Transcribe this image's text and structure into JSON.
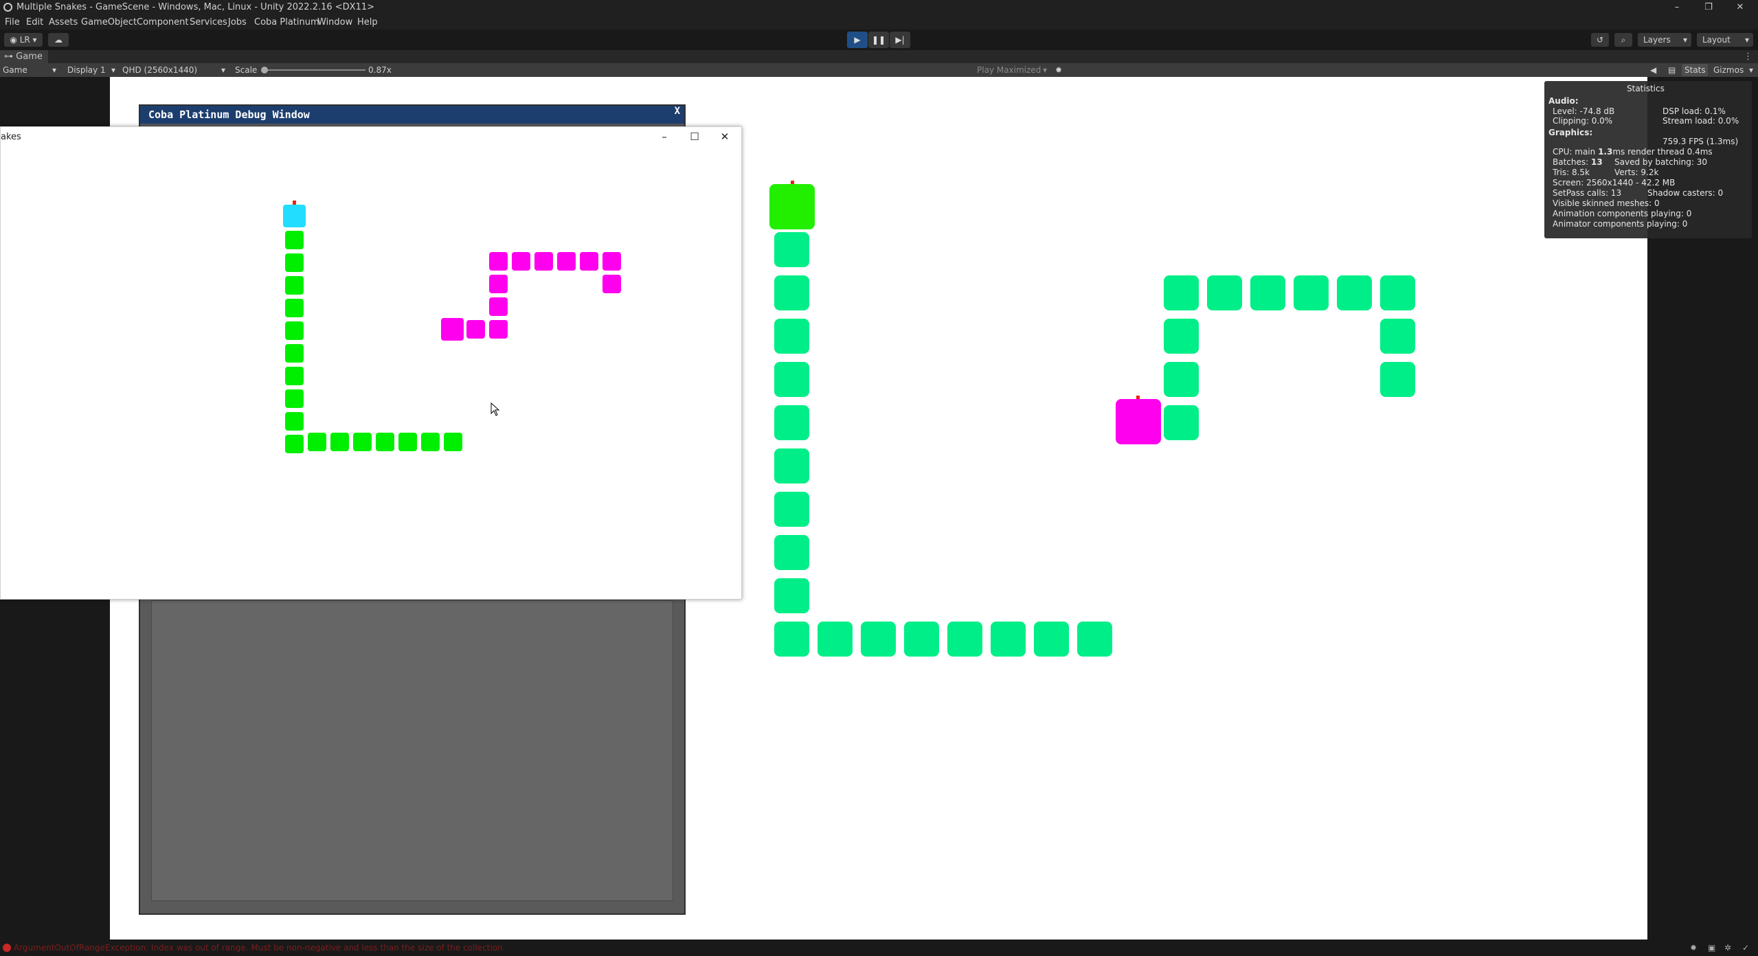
{
  "window": {
    "title": "Multiple Snakes - GameScene - Windows, Mac, Linux - Unity 2022.2.16 <DX11>",
    "controls": [
      "–",
      "❐",
      "✕"
    ]
  },
  "menubar": [
    "File",
    "Edit",
    "Assets",
    "GameObject",
    "Component",
    "Services",
    "Jobs",
    "Coba Platinum",
    "Window",
    "Help"
  ],
  "toolbar": {
    "account": "LR",
    "layers": "Layers",
    "layout": "Layout"
  },
  "game_tab": {
    "label": "Game"
  },
  "game_toolbar": {
    "view": "Game",
    "display": "Display 1",
    "resolution": "QHD (2560x1440)",
    "scale_label": "Scale",
    "scale_value": "0.87x",
    "play_mode": "Play Maximized",
    "stats": "Stats",
    "gizmos": "Gizmos"
  },
  "debug_window": {
    "title": "Coba Platinum Debug Window",
    "close": "X"
  },
  "floating_window": {
    "title": "akes",
    "controls": [
      "–",
      "☐",
      "✕"
    ]
  },
  "statistics": {
    "title": "Statistics",
    "audio_label": "Audio:",
    "level": "Level: -74.8 dB",
    "dsp_load": "DSP load: 0.1%",
    "clipping": "Clipping: 0.0%",
    "stream_load": "Stream load: 0.0%",
    "graphics_label": "Graphics:",
    "fps": "759.3 FPS (1.3ms)",
    "cpu_prefix": "CPU: main ",
    "cpu_main": "1.3",
    "cpu_suffix": "ms  render thread 0.4ms",
    "batches_prefix": "Batches: ",
    "batches": "13",
    "saved_by_batching": "Saved by batching: 30",
    "tris": "Tris: 8.5k",
    "verts": "Verts: 9.2k",
    "screen": "Screen: 2560x1440 - 42.2 MB",
    "setpass": "SetPass calls: 13",
    "shadow_casters": "Shadow casters: 0",
    "skinned_meshes": "Visible skinned meshes: 0",
    "animation_components": "Animation components playing: 0",
    "animator_components": "Animator components playing: 0"
  },
  "status_bar": {
    "error": "ArgumentOutOfRangeException: Index was out of range. Must be non-negative and less than the size of the collection."
  },
  "colors": {
    "green_snake_head": "#22ee00",
    "green_snake_body": "#00ee88",
    "magenta": "#ff00ee",
    "cyan_head": "#22ddff",
    "small_green": "#00ee00",
    "error_red": "#c82828"
  }
}
